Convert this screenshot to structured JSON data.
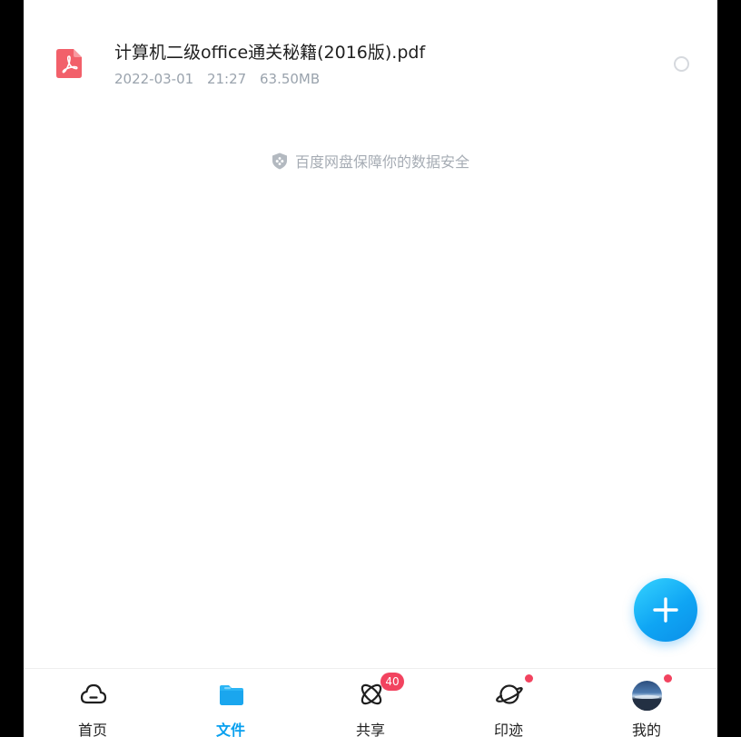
{
  "file": {
    "name": "计算机二级office通关秘籍(2016版).pdf",
    "date": "2022-03-01",
    "time": "21:27",
    "size": "63.50MB",
    "icon": "pdf-icon",
    "icon_color": "#f2606a"
  },
  "safety_note": "百度网盘保障你的数据安全",
  "fab": {
    "icon": "plus-icon"
  },
  "nav": {
    "items": [
      {
        "label": "首页",
        "icon": "cloud-icon"
      },
      {
        "label": "文件",
        "icon": "folder-icon",
        "active": true
      },
      {
        "label": "共享",
        "icon": "share-icon",
        "badge": "40"
      },
      {
        "label": "印迹",
        "icon": "planet-icon",
        "dot": true
      },
      {
        "label": "我的",
        "icon": "avatar",
        "dot": true
      }
    ]
  },
  "colors": {
    "accent": "#08a0ef",
    "badge": "#f2435f",
    "text": "#1f1f1f",
    "meta": "#9aa3ad"
  }
}
